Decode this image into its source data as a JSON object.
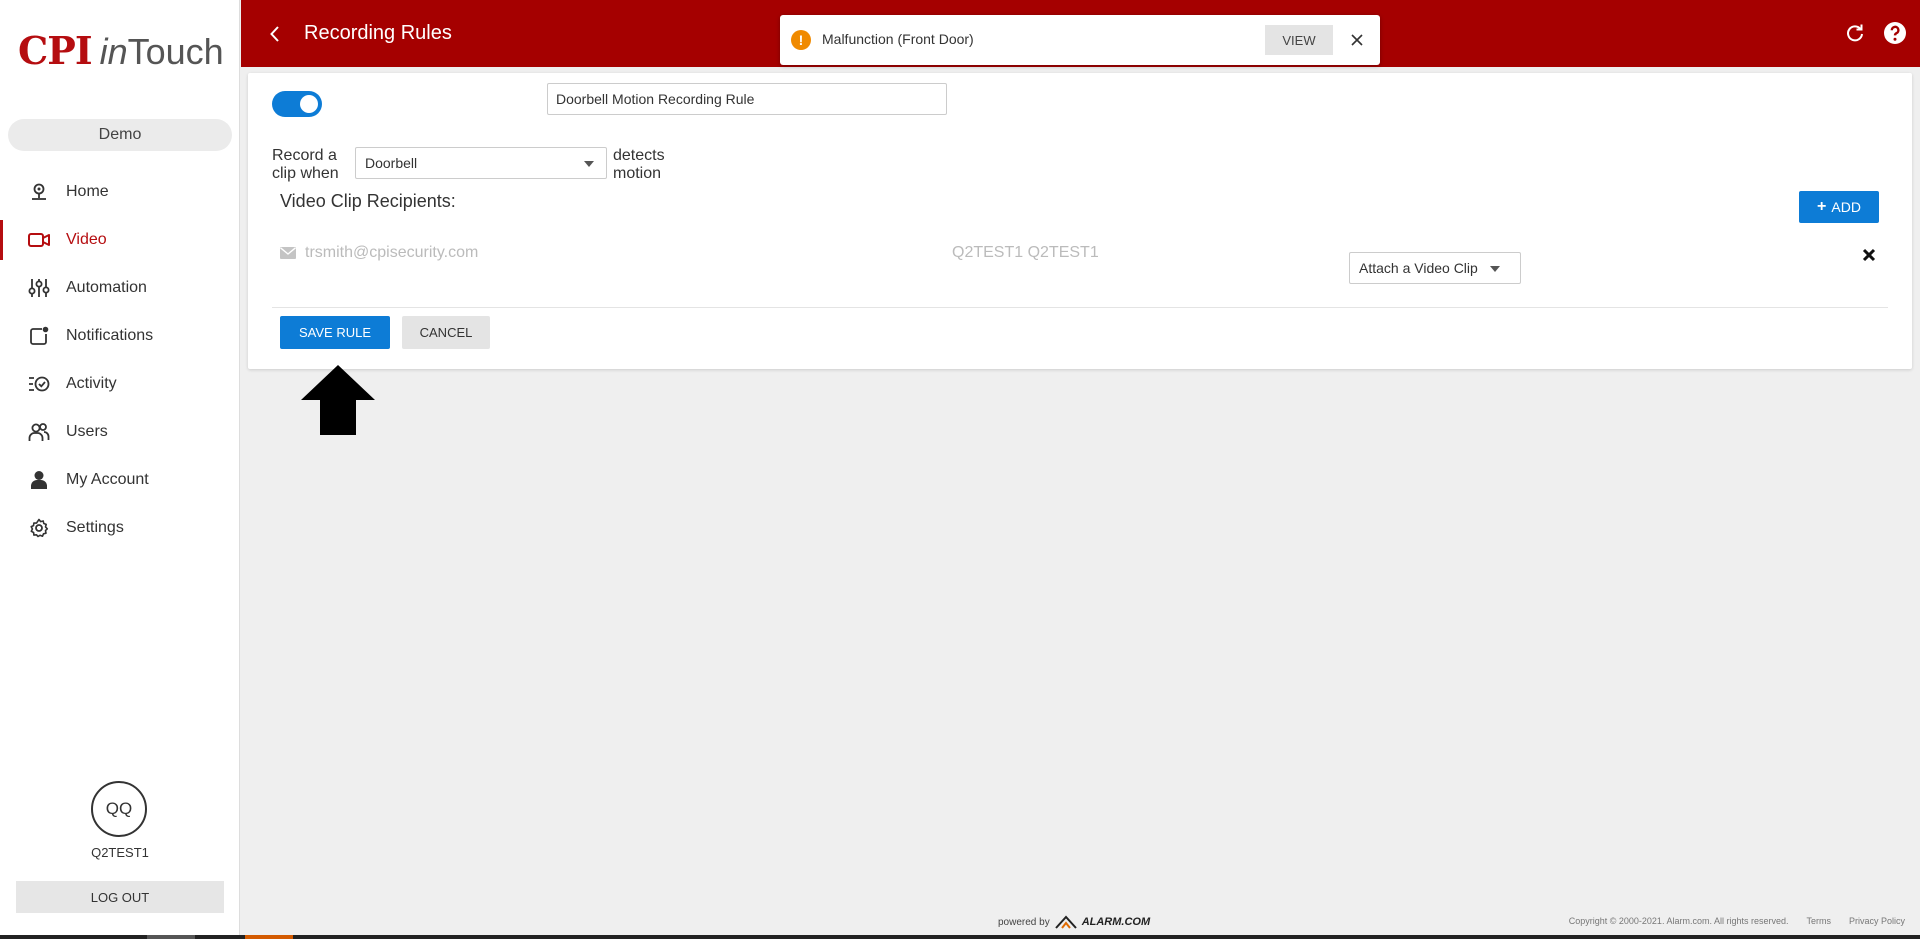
{
  "sidebar": {
    "logo": {
      "cpi": "CPI",
      "in": "in",
      "touch": "Touch"
    },
    "location": "Demo",
    "items": [
      {
        "label": "Home",
        "icon": "home-pin-icon"
      },
      {
        "label": "Video",
        "icon": "video-camera-icon",
        "active": true
      },
      {
        "label": "Automation",
        "icon": "sliders-icon"
      },
      {
        "label": "Notifications",
        "icon": "notification-icon"
      },
      {
        "label": "Activity",
        "icon": "activity-icon"
      },
      {
        "label": "Users",
        "icon": "users-icon"
      },
      {
        "label": "My Account",
        "icon": "person-icon"
      },
      {
        "label": "Settings",
        "icon": "gear-icon"
      }
    ],
    "user": {
      "initials": "QQ",
      "name": "Q2TEST1"
    },
    "logout_label": "LOG OUT"
  },
  "header": {
    "title": "Recording Rules",
    "background": "#a50000"
  },
  "toast": {
    "text": "Malfunction (Front Door)",
    "view_label": "VIEW",
    "icon_color": "#f08a00"
  },
  "rule": {
    "enabled": true,
    "name": "Doorbell Motion Recording Rule",
    "record_prefix": "Record a clip when",
    "device": "Doorbell",
    "record_suffix": "detects motion",
    "recipients_title": "Video Clip Recipients:",
    "add_label": "ADD",
    "recipients": [
      {
        "email": "trsmith@cpisecurity.com",
        "name": "Q2TEST1 Q2TEST1",
        "action": "Attach a Video Clip"
      }
    ],
    "save_label": "SAVE RULE",
    "cancel_label": "CANCEL",
    "accent": "#0d7cd6"
  },
  "footer": {
    "powered_by": "powered by",
    "brand": "ALARM.COM",
    "copyright": "Copyright © 2000-2021. Alarm.com. All rights reserved.",
    "terms": "Terms",
    "privacy": "Privacy Policy"
  }
}
